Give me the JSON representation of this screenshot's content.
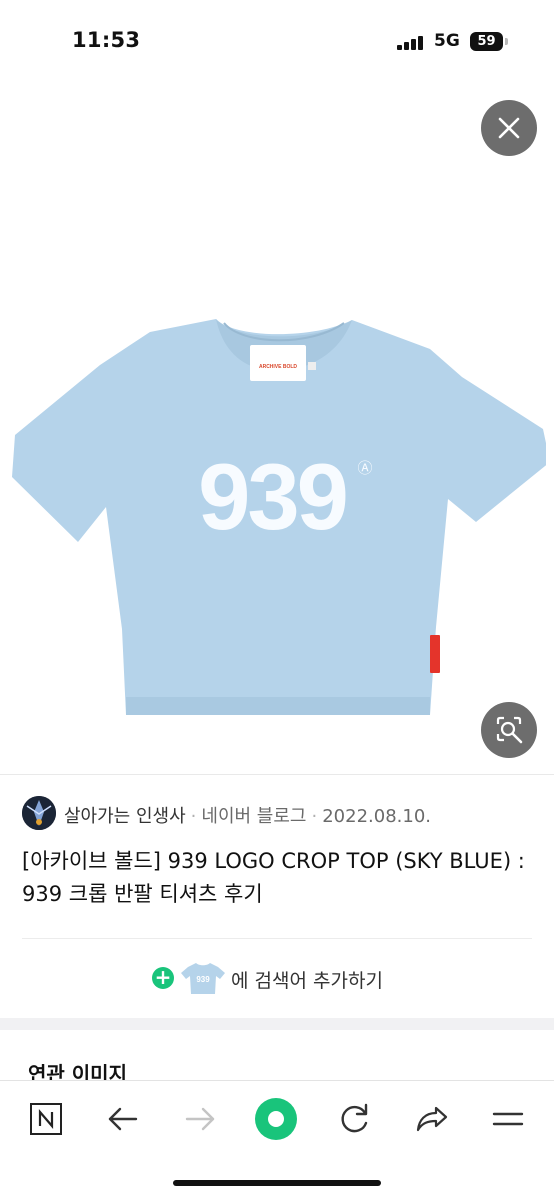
{
  "status_bar": {
    "time": "11:53",
    "network": "5G",
    "battery": "59"
  },
  "viewer": {
    "close_icon": "close-icon",
    "lens_icon": "image-search-icon",
    "product": {
      "shirt_color": "#b5d3ea",
      "print_text": "939",
      "print_mark": "Ⓐ",
      "label_text": "ARCHIVE BOLD"
    }
  },
  "result": {
    "source_name": "살아가는 인생사",
    "source_platform": "네이버 블로그",
    "date": "2022.08.10.",
    "title": "[아카이브 볼드] 939 LOGO CROP TOP (SKY BLUE) : 939 크롭 반팔 티셔츠 후기",
    "add_term_label": "에 검색어 추가하기",
    "thumb_text": "939"
  },
  "related": {
    "heading": "연관 이미지"
  },
  "toolbar": {
    "items": [
      "naver-home-icon",
      "back-arrow-icon",
      "forward-arrow-icon",
      "green-dot-icon",
      "reload-icon",
      "share-icon",
      "menu-icon"
    ]
  },
  "colors": {
    "accent_green": "#19c47b",
    "overlay_button": "#6d6d6d"
  }
}
